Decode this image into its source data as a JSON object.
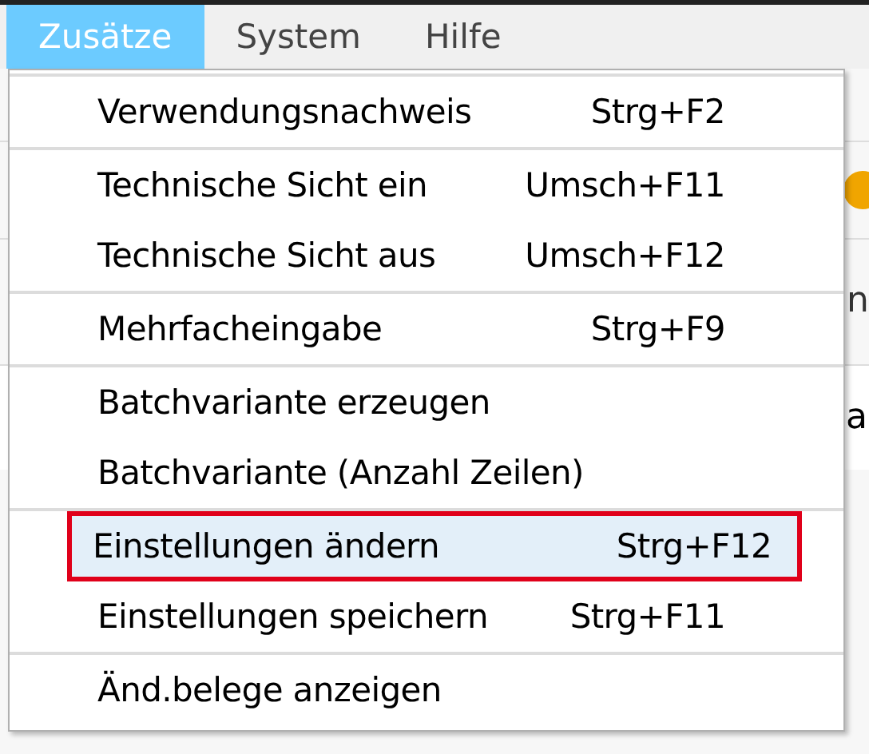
{
  "menubar": [
    {
      "label": "Zusätze",
      "selected": true
    },
    {
      "label": "System",
      "selected": false
    },
    {
      "label": "Hilfe",
      "selected": false
    }
  ],
  "background": {
    "right_fragments": [
      "n",
      "a"
    ]
  },
  "menu": {
    "groups": [
      {
        "items": [
          {
            "label": "Verwendungsnachweis",
            "shortcut": "Strg+F2",
            "selected": false
          }
        ]
      },
      {
        "items": [
          {
            "label": "Technische Sicht ein",
            "shortcut": "Umsch+F11",
            "selected": false
          },
          {
            "label": "Technische Sicht aus",
            "shortcut": "Umsch+F12",
            "selected": false
          }
        ]
      },
      {
        "items": [
          {
            "label": "Mehrfacheingabe",
            "shortcut": "Strg+F9",
            "selected": false
          }
        ]
      },
      {
        "items": [
          {
            "label": "Batchvariante erzeugen",
            "selected": false
          },
          {
            "label": "Batchvariante (Anzahl Zeilen)",
            "selected": false
          }
        ]
      },
      {
        "items": [
          {
            "label": "Einstellungen ändern",
            "shortcut": "Strg+F12",
            "selected": true
          },
          {
            "label": "Einstellungen speichern",
            "shortcut": "Strg+F11",
            "selected": false
          }
        ]
      },
      {
        "items": [
          {
            "label": "Änd.belege anzeigen",
            "selected": false
          }
        ]
      }
    ]
  }
}
